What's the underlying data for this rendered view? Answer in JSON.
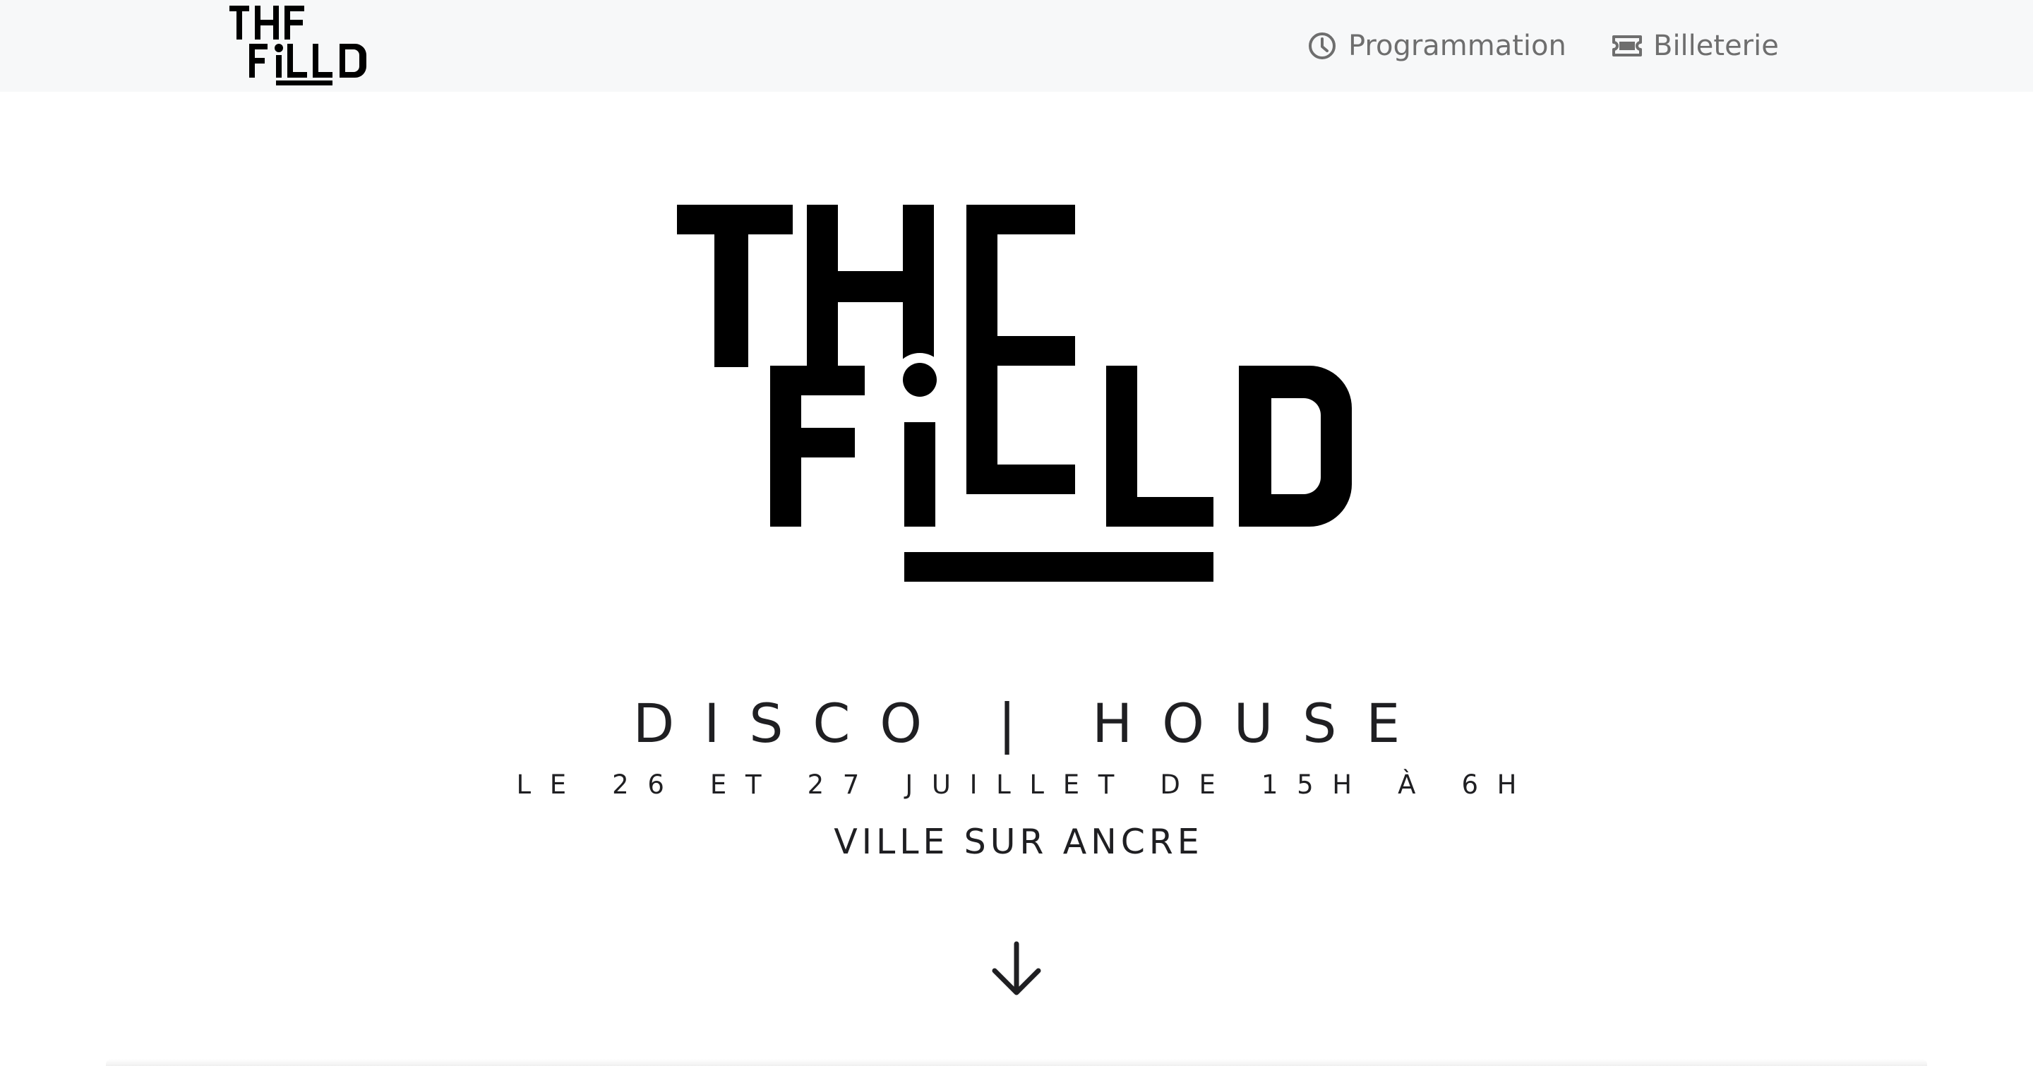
{
  "nav": {
    "logo_icon": "the-field-logo",
    "links": [
      {
        "label": "Programmation",
        "icon": "clock-icon"
      },
      {
        "label": "Billeterie",
        "icon": "ticket-icon"
      }
    ]
  },
  "hero": {
    "logo_icon": "the-field-logo",
    "genres": "DISCO | HOUSE",
    "dates": "LE 26 ET 27 JUILLET DE 15H À 6H",
    "place": "VILLE SUR ANCRE",
    "scroll_icon": "arrow-down-icon"
  },
  "colors": {
    "nav_bg": "#f7f8f9",
    "nav_text": "#6e6e6e",
    "text": "#1f1f22",
    "logo": "#000000"
  }
}
